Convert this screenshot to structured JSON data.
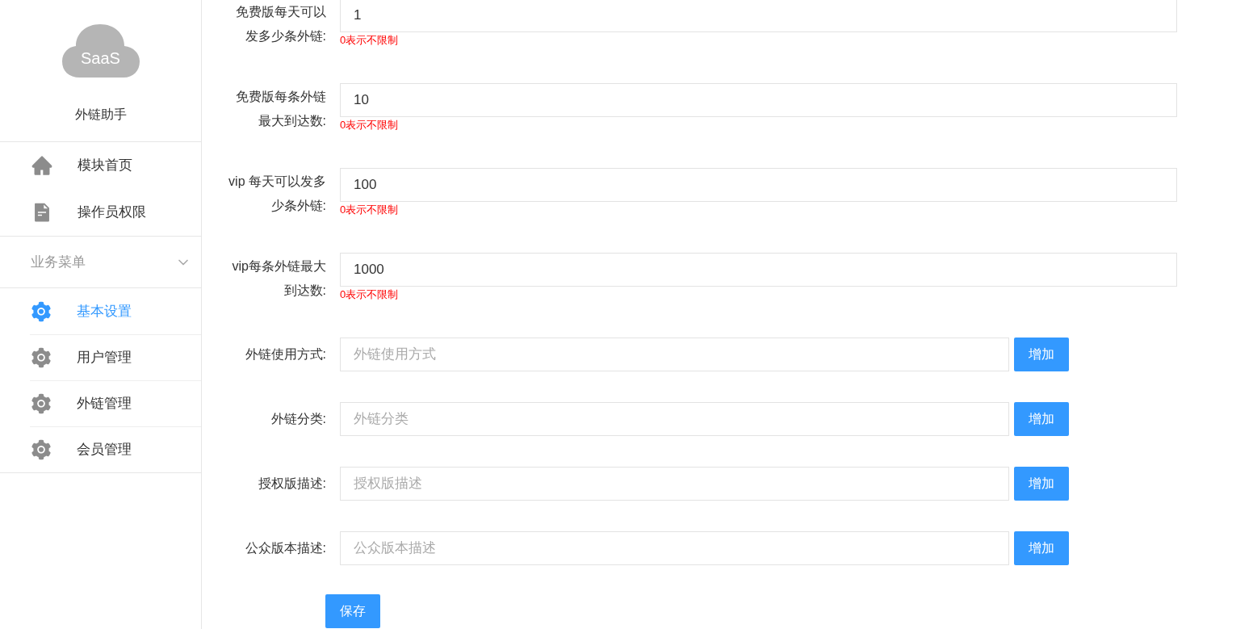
{
  "sidebar": {
    "logo_text": "SaaS",
    "app_name": "外链助手",
    "top_items": [
      {
        "label": "模块首页",
        "kind": "home",
        "selected": false
      },
      {
        "label": "操作员权限",
        "kind": "doc",
        "selected": false
      }
    ],
    "group": {
      "label": "业务菜单",
      "expanded": true,
      "children": [
        {
          "label": "基本设置",
          "selected": true
        },
        {
          "label": "用户管理",
          "selected": false
        },
        {
          "label": "外链管理",
          "selected": false
        },
        {
          "label": "会员管理",
          "selected": false
        }
      ]
    }
  },
  "form": {
    "fields": [
      {
        "kind": "number",
        "label": "免费版每天可以发多少条外链:",
        "value": "1",
        "hint": "0表示不限制"
      },
      {
        "kind": "number",
        "label": "免费版每条外链最大到达数:",
        "value": "10",
        "hint": "0表示不限制"
      },
      {
        "kind": "number",
        "label": "vip 每天可以发多少条外链:",
        "value": "100",
        "hint": "0表示不限制"
      },
      {
        "kind": "number",
        "label": "vip每条外链最大到达数:",
        "value": "1000",
        "hint": "0表示不限制"
      },
      {
        "kind": "list",
        "label": "外链使用方式:",
        "placeholder": "外链使用方式",
        "button": "增加"
      },
      {
        "kind": "list",
        "label": "外链分类:",
        "placeholder": "外链分类",
        "button": "增加"
      },
      {
        "kind": "list",
        "label": "授权版描述:",
        "placeholder": "授权版描述",
        "button": "增加"
      },
      {
        "kind": "list",
        "label": "公众版本描述:",
        "placeholder": "公众版本描述",
        "button": "增加"
      }
    ],
    "save_button": "保存"
  }
}
